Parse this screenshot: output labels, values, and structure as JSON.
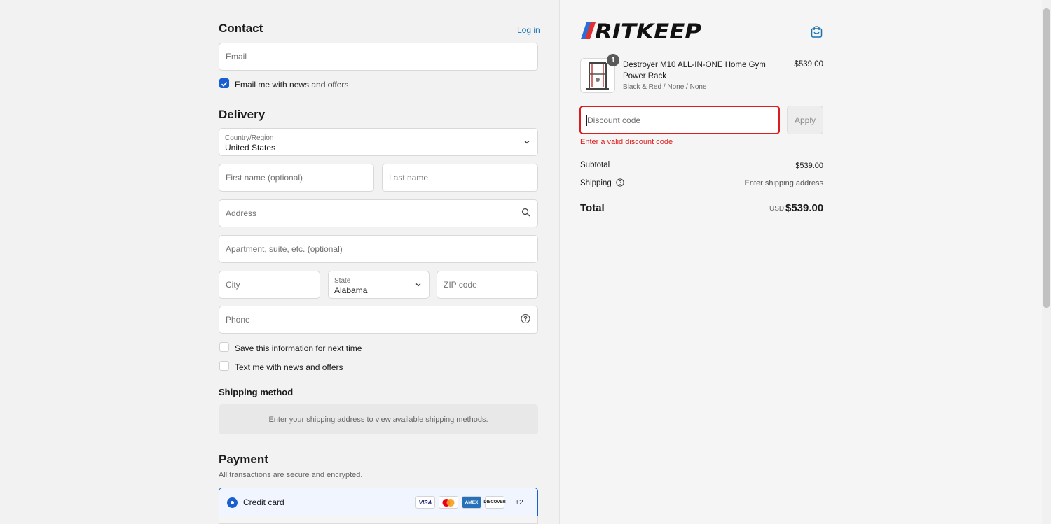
{
  "contact": {
    "title": "Contact",
    "login_link": "Log in",
    "email_placeholder": "Email",
    "newsletter_label": "Email me with news and offers",
    "newsletter_checked": true
  },
  "delivery": {
    "title": "Delivery",
    "country_label": "Country/Region",
    "country_value": "United States",
    "first_name_placeholder": "First name (optional)",
    "last_name_placeholder": "Last name",
    "address_placeholder": "Address",
    "apartment_placeholder": "Apartment, suite, etc. (optional)",
    "city_placeholder": "City",
    "state_label": "State",
    "state_value": "Alabama",
    "zip_placeholder": "ZIP code",
    "phone_placeholder": "Phone",
    "save_info_label": "Save this information for next time",
    "text_me_label": "Text me with news and offers"
  },
  "shipping_method": {
    "title": "Shipping method",
    "placeholder_text": "Enter your shipping address to view available shipping methods."
  },
  "payment": {
    "title": "Payment",
    "subtitle": "All transactions are secure and encrypted.",
    "option_label": "Credit card",
    "card_brands": [
      "VISA",
      "Mastercard",
      "AMEX",
      "DISCOVER"
    ],
    "more_brands": "+2"
  },
  "summary": {
    "brand": "RITKEEP",
    "item": {
      "quantity": "1",
      "name": "Destroyer M10 ALL-IN-ONE Home Gym Power Rack",
      "variant": "Black & Red / None / None",
      "price": "$539.00"
    },
    "discount_placeholder": "Discount code",
    "apply_label": "Apply",
    "discount_error": "Enter a valid discount code",
    "subtotal_label": "Subtotal",
    "subtotal_value": "$539.00",
    "shipping_label": "Shipping",
    "shipping_value": "Enter shipping address",
    "total_label": "Total",
    "total_currency": "USD",
    "total_value": "$539.00"
  },
  "colors": {
    "accent": "#1a5fd0",
    "link": "#1773b0",
    "error": "#dd1d1d",
    "brand_red": "#e03030",
    "brand_blue": "#2a6fd8"
  }
}
